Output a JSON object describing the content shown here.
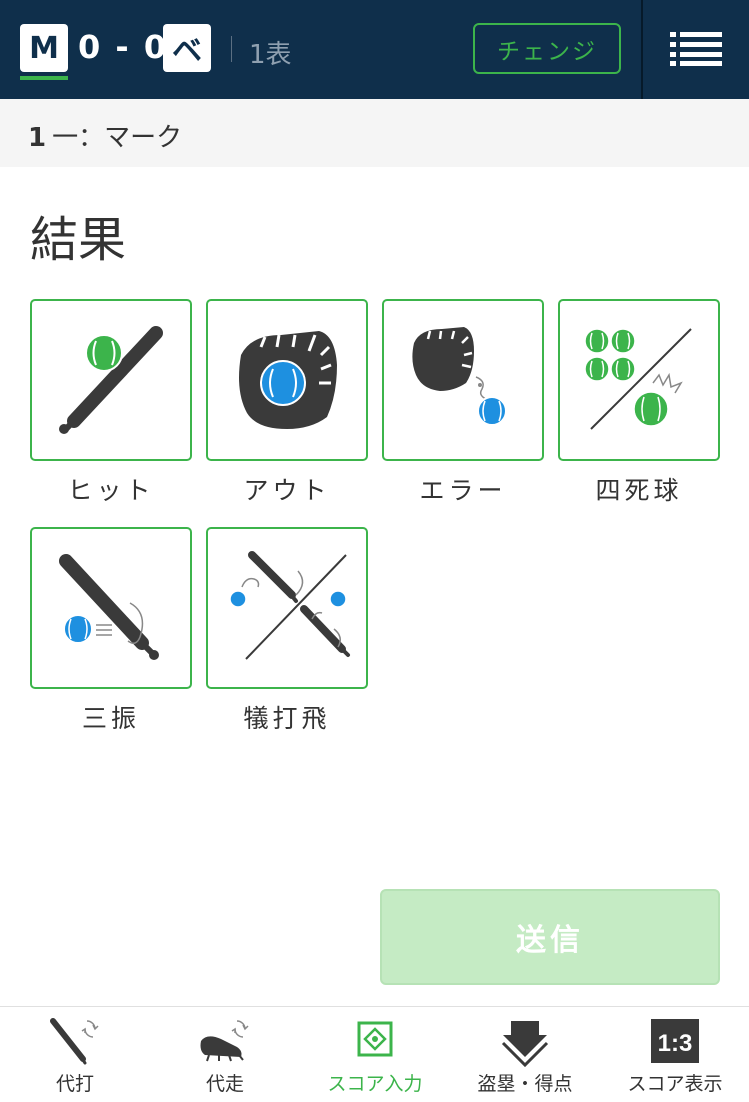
{
  "header": {
    "home_team": "M",
    "away_team": "ベ",
    "score": "0 - 0",
    "inning": "1表",
    "change_label": "チェンジ",
    "menu_icon": "hamburger-menu-icon"
  },
  "batter": {
    "order": "1",
    "name": "一：マーク"
  },
  "section_title": "結果",
  "results": [
    {
      "label": "ヒット",
      "icon": "hit-icon"
    },
    {
      "label": "アウト",
      "icon": "out-icon"
    },
    {
      "label": "エラー",
      "icon": "error-icon"
    },
    {
      "label": "四死球",
      "icon": "walk-icon"
    },
    {
      "label": "三振",
      "icon": "strikeout-icon"
    },
    {
      "label": "犠打飛",
      "icon": "sacrifice-icon"
    }
  ],
  "send_label": "送信",
  "nav": [
    {
      "label": "代打",
      "icon": "pinch-hitter-icon",
      "active": false
    },
    {
      "label": "代走",
      "icon": "pinch-runner-icon",
      "active": false
    },
    {
      "label": "スコア入力",
      "icon": "score-input-icon",
      "active": true
    },
    {
      "label": "盗塁・得点",
      "icon": "steal-score-icon",
      "active": false
    },
    {
      "label": "スコア表示",
      "icon": "score-display-icon",
      "active": false
    }
  ],
  "score_display_icon_text": "1:3",
  "colors": {
    "header_bg": "#0f2f4b",
    "accent": "#3cb44b",
    "ball_green": "#3cb44b",
    "ball_blue": "#1e90e0",
    "icon_dark": "#3a3a3a",
    "send_disabled": "#c5ebc4"
  }
}
